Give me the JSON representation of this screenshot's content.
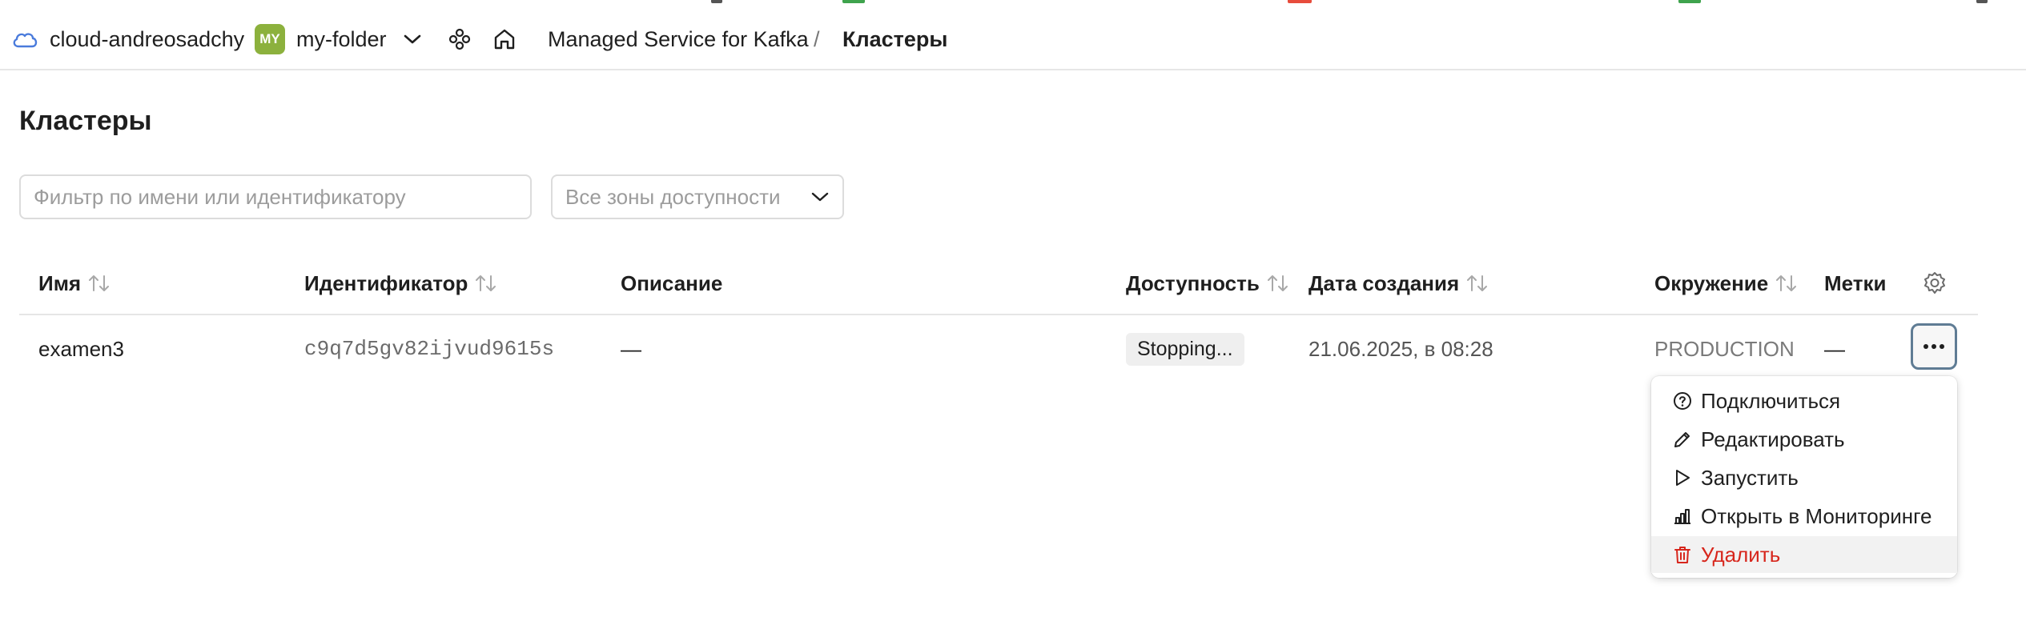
{
  "header": {
    "cloud_name": "cloud-andreosadchy",
    "folder_avatar": "MY",
    "folder_name": "my-folder",
    "breadcrumb_service": "Managed Service for Kafka",
    "breadcrumb_separator": "/",
    "breadcrumb_current": "Кластеры",
    "icons": [
      "cloud-icon",
      "chevron-down-icon",
      "services-icon",
      "home-icon"
    ]
  },
  "page": {
    "title": "Кластеры"
  },
  "filters": {
    "search_placeholder": "Фильтр по имени или идентификатору",
    "zone_select_value": "Все зоны доступности"
  },
  "table": {
    "columns": [
      "Имя",
      "Идентификатор",
      "Описание",
      "Доступность",
      "Дата создания",
      "Окружение",
      "Метки"
    ],
    "rows": [
      {
        "name": "examen3",
        "id": "c9q7d5gv82ijvud9615s",
        "description": "—",
        "status": "Stopping...",
        "created": "21.06.2025, в 08:28",
        "environment": "PRODUCTION",
        "labels": "—"
      }
    ]
  },
  "menu": {
    "items": [
      {
        "label": "Подключиться",
        "icon": "question-circle-icon"
      },
      {
        "label": "Редактировать",
        "icon": "pencil-icon"
      },
      {
        "label": "Запустить",
        "icon": "play-icon"
      },
      {
        "label": "Открыть в Мониторинге",
        "icon": "chart-icon"
      },
      {
        "label": "Удалить",
        "icon": "trash-icon"
      }
    ]
  },
  "colors": {
    "accent_avatar": "#8cb13d",
    "danger": "#d7261c",
    "focus_border": "#5f7c94"
  }
}
